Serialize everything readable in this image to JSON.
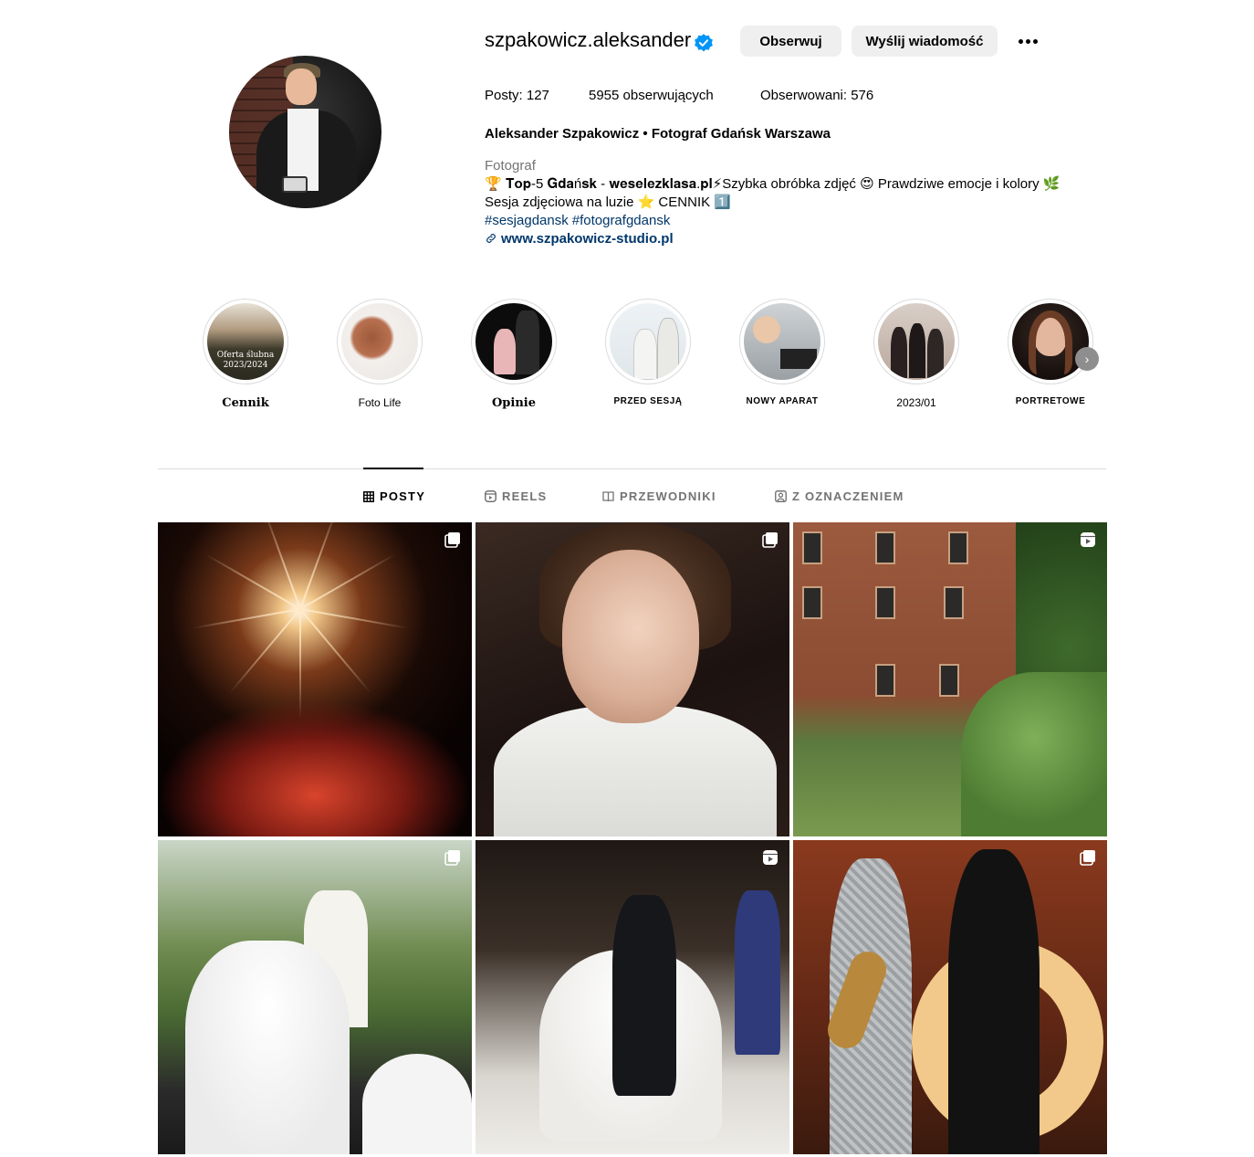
{
  "profile": {
    "username": "szpakowicz.aleksander",
    "verified": true,
    "follow_label": "Obserwuj",
    "message_label": "Wyślij wiadomość",
    "stats": {
      "posts_label": "Posty:",
      "posts": "127",
      "followers": "5955",
      "followers_label": "obserwujących",
      "following_label": "Obserwowani:",
      "following": "576"
    },
    "full_name": "Aleksander Szpakowicz • Fotograf Gdańsk Warszawa",
    "category": "Fotograf",
    "bio_line1": "🏆 𝐓𝐨𝐩-5 𝐆𝐝𝐚ń𝐬𝐤 - 𝐰𝐞𝐬𝐞𝐥𝐞𝐳𝐤𝐥𝐚𝐬𝐚.𝐩𝐥⚡Szybka obróbka zdjęć 😍 Prawdziwe emocje i kolory 🌿",
    "bio_line2": "Sesja zdjęciowa na luzie ⭐ CENNIK 1️⃣",
    "hashtags": [
      "#sesjagdansk",
      "#fotografgdansk"
    ],
    "website": "www.szpakowicz-studio.pl",
    "accent_color": "#0095f6",
    "link_color": "#00376b"
  },
  "highlights": [
    {
      "label": "Cennik",
      "cover_text": "Oferta ślubna 2023/2024"
    },
    {
      "label": "Foto Life"
    },
    {
      "label": "Opinie"
    },
    {
      "label": "PRZED SESJĄ"
    },
    {
      "label": "NOWY APARAT"
    },
    {
      "label": "2023/01"
    },
    {
      "label": "PORTRETOWE"
    }
  ],
  "tabs": [
    {
      "label": "POSTY",
      "icon": "grid-icon",
      "active": true
    },
    {
      "label": "REELS",
      "icon": "reels-icon",
      "active": false
    },
    {
      "label": "PRZEWODNIKI",
      "icon": "guide-icon",
      "active": false
    },
    {
      "label": "Z OZNACZENIEM",
      "icon": "tagged-icon",
      "active": false
    }
  ],
  "posts": [
    {
      "subject": "fireworks",
      "badge": "carousel-icon"
    },
    {
      "subject": "bride portrait",
      "badge": "carousel-icon"
    },
    {
      "subject": "brick manor",
      "badge": "reel-icon"
    },
    {
      "subject": "wedding ceremony",
      "badge": "carousel-icon"
    },
    {
      "subject": "first dance",
      "badge": "reel-icon"
    },
    {
      "subject": "saxophonist and photographer",
      "badge": "carousel-icon"
    }
  ]
}
